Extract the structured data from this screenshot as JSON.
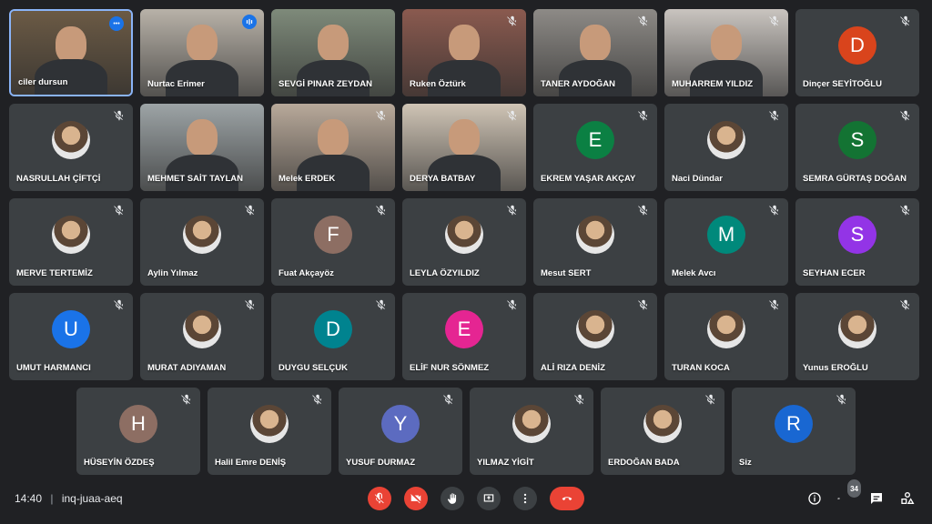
{
  "participants": [
    {
      "name": "ciler dursun",
      "type": "video",
      "bg": "#6b5a45",
      "active": true,
      "indicator": "more"
    },
    {
      "name": "Nurtac Erimer",
      "type": "video",
      "bg": "#b8b2a8",
      "indicator": "speaking"
    },
    {
      "name": "SEVGİ PINAR ZEYDAN",
      "type": "video",
      "bg": "#7e8a7a"
    },
    {
      "name": "Ruken Öztürk",
      "type": "video",
      "bg": "#8a5a4f",
      "indicator": "muted"
    },
    {
      "name": "TANER AYDOĞAN",
      "type": "video",
      "bg": "#8d8a86",
      "indicator": "muted"
    },
    {
      "name": "MUHARREM YILDIZ",
      "type": "video",
      "bg": "#c9c4bf",
      "indicator": "muted"
    },
    {
      "name": "Dinçer SEYİTOĞLU",
      "type": "initial",
      "initial": "D",
      "color": "#d9441c",
      "indicator": "muted"
    },
    {
      "name": "NASRULLAH ÇİFTÇİ",
      "type": "photo",
      "indicator": "muted"
    },
    {
      "name": "MEHMET SAİT TAYLAN",
      "type": "video",
      "bg": "#9da4a6"
    },
    {
      "name": "Melek ERDEK",
      "type": "video",
      "bg": "#b8a99a",
      "indicator": "muted"
    },
    {
      "name": "DERYA BATBAY",
      "type": "video",
      "bg": "#cfc4b5",
      "indicator": "muted"
    },
    {
      "name": "EKREM YAŞAR AKÇAY",
      "type": "initial",
      "initial": "E",
      "color": "#0b8043",
      "indicator": "muted"
    },
    {
      "name": "Naci Dündar",
      "type": "photo",
      "indicator": "muted"
    },
    {
      "name": "SEMRA GÜRTAŞ DOĞAN",
      "type": "initial",
      "initial": "S",
      "color": "#137333",
      "indicator": "muted"
    },
    {
      "name": "MERVE TERTEMİZ",
      "type": "photo",
      "indicator": "muted"
    },
    {
      "name": "Aylin Yılmaz",
      "type": "photo",
      "indicator": "muted"
    },
    {
      "name": "Fuat Akçayöz",
      "type": "initial",
      "initial": "F",
      "color": "#8d6e63",
      "indicator": "muted"
    },
    {
      "name": "LEYLA ÖZYILDIZ",
      "type": "photo",
      "indicator": "muted"
    },
    {
      "name": "Mesut SERT",
      "type": "photo",
      "indicator": "muted"
    },
    {
      "name": "Melek Avcı",
      "type": "initial",
      "initial": "M",
      "color": "#00897b",
      "indicator": "muted"
    },
    {
      "name": "SEYHAN ECER",
      "type": "initial",
      "initial": "S",
      "color": "#9334e6",
      "indicator": "muted"
    },
    {
      "name": "UMUT HARMANCI",
      "type": "initial",
      "initial": "U",
      "color": "#1a73e8",
      "indicator": "muted"
    },
    {
      "name": "MURAT ADIYAMAN",
      "type": "photo",
      "indicator": "muted"
    },
    {
      "name": "DUYGU SELÇUK",
      "type": "initial",
      "initial": "D",
      "color": "#00838f",
      "indicator": "muted"
    },
    {
      "name": "ELİF NUR SÖNMEZ",
      "type": "initial",
      "initial": "E",
      "color": "#e52592",
      "indicator": "muted"
    },
    {
      "name": "ALİ RIZA DENİZ",
      "type": "photo",
      "indicator": "muted"
    },
    {
      "name": "TURAN KOCA",
      "type": "photo",
      "indicator": "muted"
    },
    {
      "name": "Yunus EROĞLU",
      "type": "photo",
      "indicator": "muted"
    },
    {
      "name": "HÜSEYİN ÖZDEŞ",
      "type": "initial",
      "initial": "H",
      "color": "#8d6e63",
      "indicator": "muted"
    },
    {
      "name": "Halil Emre DENİŞ",
      "type": "photo",
      "indicator": "muted"
    },
    {
      "name": "YUSUF DURMAZ",
      "type": "initial",
      "initial": "Y",
      "color": "#5c6bc0",
      "indicator": "muted"
    },
    {
      "name": "YILMAZ YİGİT",
      "type": "photo",
      "indicator": "muted"
    },
    {
      "name": "ERDOĞAN BADA",
      "type": "photo",
      "indicator": "muted"
    },
    {
      "name": "Siz",
      "type": "initial",
      "initial": "R",
      "color": "#1967d2",
      "indicator": "muted"
    }
  ],
  "bottom_bar": {
    "time": "14:40",
    "separator": "|",
    "meeting_code": "inq-juaa-aeq",
    "participant_count": "34"
  }
}
